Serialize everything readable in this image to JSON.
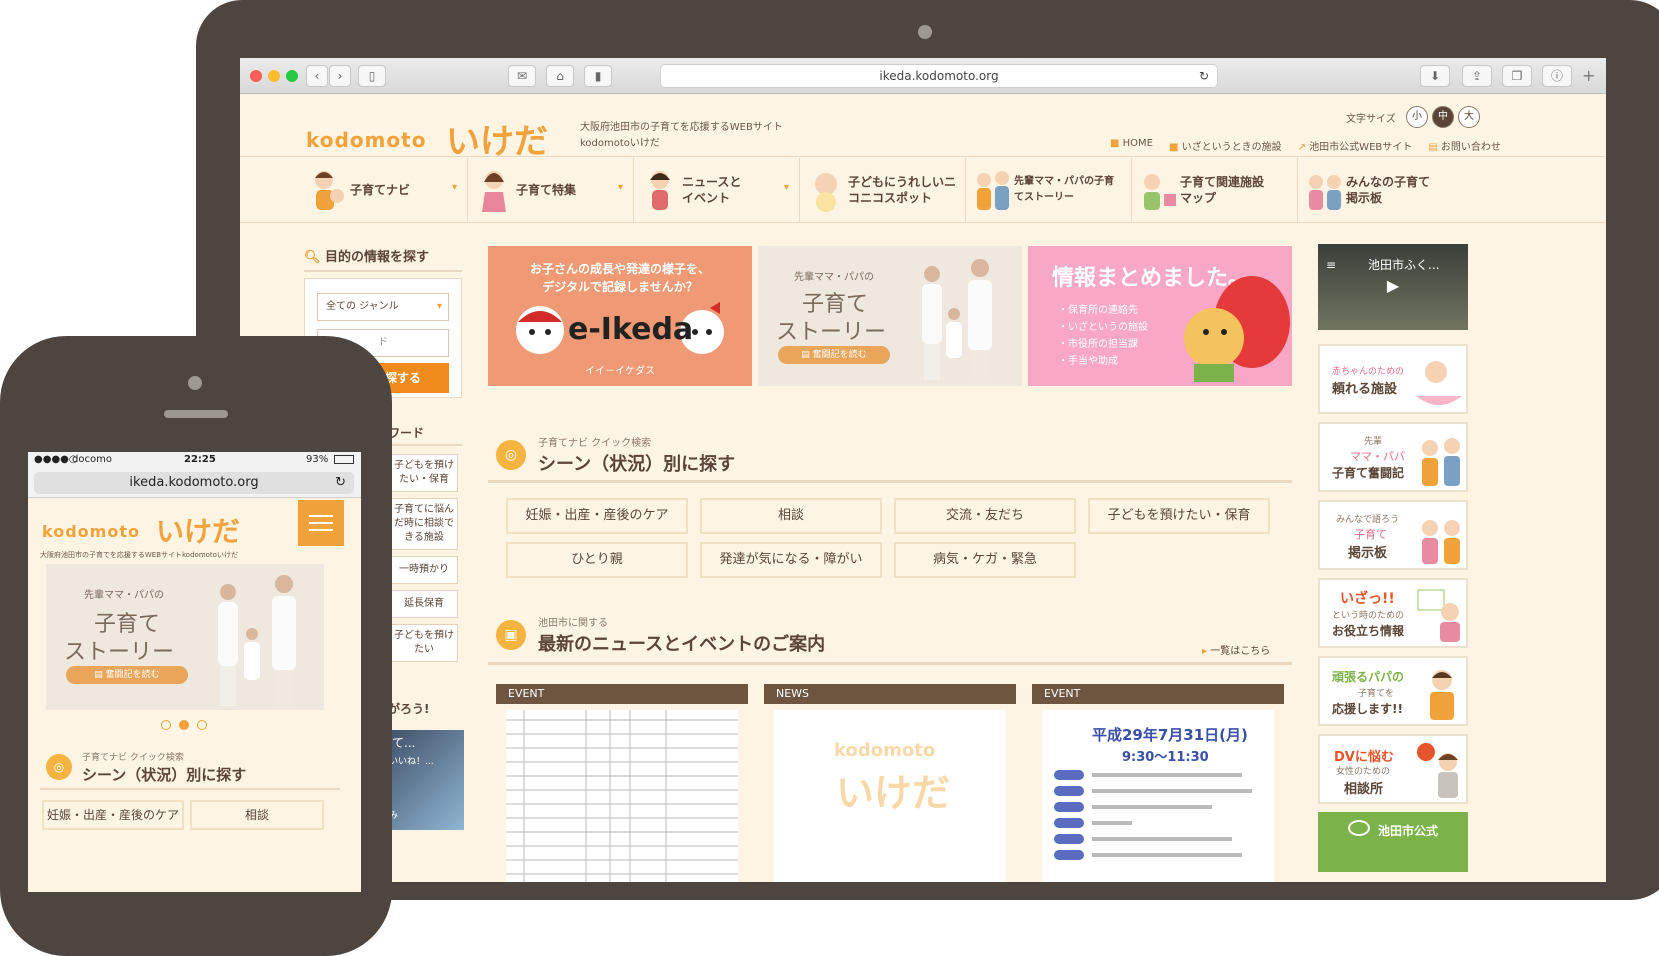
{
  "browser": {
    "url": "ikeda.kodomoto.org"
  },
  "site": {
    "logo_latin": "kodomoto",
    "logo_kana": "いけだ",
    "tagline": "大阪府池田市の子育てを応援するWEBサイト",
    "tagline2": "kodomotoいけだ",
    "font_size_label": "文字サイズ",
    "font_sizes": [
      "小",
      "中",
      "大"
    ],
    "util_links": [
      "HOME",
      "いざというときの施設",
      "池田市公式WEBサイト",
      "お問い合わせ"
    ],
    "nav": [
      {
        "label": "子育てナビ",
        "dropdown": true
      },
      {
        "label": "子育て特集",
        "dropdown": true
      },
      {
        "label": "ニュースと\nイベント",
        "dropdown": true
      },
      {
        "label": "子どもにうれしいニ\nコニコスポット",
        "dropdown": false
      },
      {
        "label": "先輩ママ・パパの子育\nてストーリー",
        "dropdown": false
      },
      {
        "label": "子育て関連施設\nマップ",
        "dropdown": false
      },
      {
        "label": "みんなの子育て\n掲示板",
        "dropdown": false
      }
    ],
    "search": {
      "title": "目的の情報を探す",
      "genre_select": "全ての ジャンル",
      "keyword_placeholder": "キーワード",
      "keyword_visible": "ド",
      "button": "探する"
    },
    "keyword_section": "ーワード",
    "keywords": [
      "子どもを預け\nたい・保育",
      "子育てに悩ん\nだ時に相談で\nきる施設",
      "一時預かり",
      "延長保育",
      "子どもを預け\nたい"
    ],
    "partial_heading": "ながろう!",
    "video_partial": "育て...",
    "video_partial2": "「いいね！...",
    "video_partial3": "済み",
    "banners": [
      {
        "line1": "お子さんの成長や発達の様子を、",
        "line2": "デジタルで記録しませんか？",
        "brand": "e-Ikeda",
        "reading": "イイ－イケダス"
      },
      {
        "sub": "先輩ママ・パパの",
        "title1": "子育て",
        "title2": "ストーリー",
        "button": "奮闘記を読む"
      },
      {
        "title": "情報まとめました。",
        "items": [
          "・保育所の連絡先",
          "・いざというの施設",
          "・市役所の担当課",
          "・手当や助成"
        ]
      }
    ],
    "quick_search": {
      "eyebrow": "子育てナビ クイック検索",
      "title": "シーン（状況）別に探す",
      "scenes": [
        "妊娠・出産・産後のケア",
        "相談",
        "交流・友だち",
        "子どもを預けたい・保育",
        "ひとり親",
        "発達が気になる・障がい",
        "病気・ケガ・緊急"
      ]
    },
    "news": {
      "eyebrow": "池田市に関する",
      "title": "最新のニュースとイベントのご案内",
      "more": "一覧はこちら",
      "cards": [
        {
          "tag": "EVENT"
        },
        {
          "tag": "NEWS"
        },
        {
          "tag": "EVENT",
          "date_text": "平成29年7月31日(月)",
          "time_text": "9:30～11:30"
        }
      ]
    },
    "video": {
      "title": "池田市ふく..."
    },
    "side_banners": [
      {
        "small": "赤ちゃんのための",
        "big": "頼れる施設"
      },
      {
        "small": "先輩",
        "mid": "ママ・パパ",
        "big": "子育て奮闘記"
      },
      {
        "small": "みんなで語ろう",
        "mid": "子育て",
        "big": "掲示板"
      },
      {
        "mid": "いざっ!!",
        "small": "という時のための",
        "big": "お役立ち情報"
      },
      {
        "mid": "頑張るパパの",
        "small": "子育てを",
        "big": "応援します!!"
      },
      {
        "mid": "DVに悩む",
        "small": "女性のための",
        "big": "相談所"
      },
      {
        "big": "池田市公式"
      }
    ]
  },
  "phone": {
    "carrier": "docomo",
    "time": "22:25",
    "battery": "93%",
    "url": "ikeda.kodomoto.org",
    "tagline": "大阪府池田市の子育てを応援するWEBサイトkodomotoいけだ",
    "eyebrow": "子育てナビ クイック検索",
    "title": "シーン（状況）別に探す",
    "scenes": [
      "妊娠・出産・産後のケア",
      "相談"
    ]
  },
  "colors": {
    "accent": "#f2a23b",
    "brown": "#5a4536",
    "bg": "#fdf4e3",
    "device": "#4d4640",
    "orange_btn": "#f28b1e"
  }
}
